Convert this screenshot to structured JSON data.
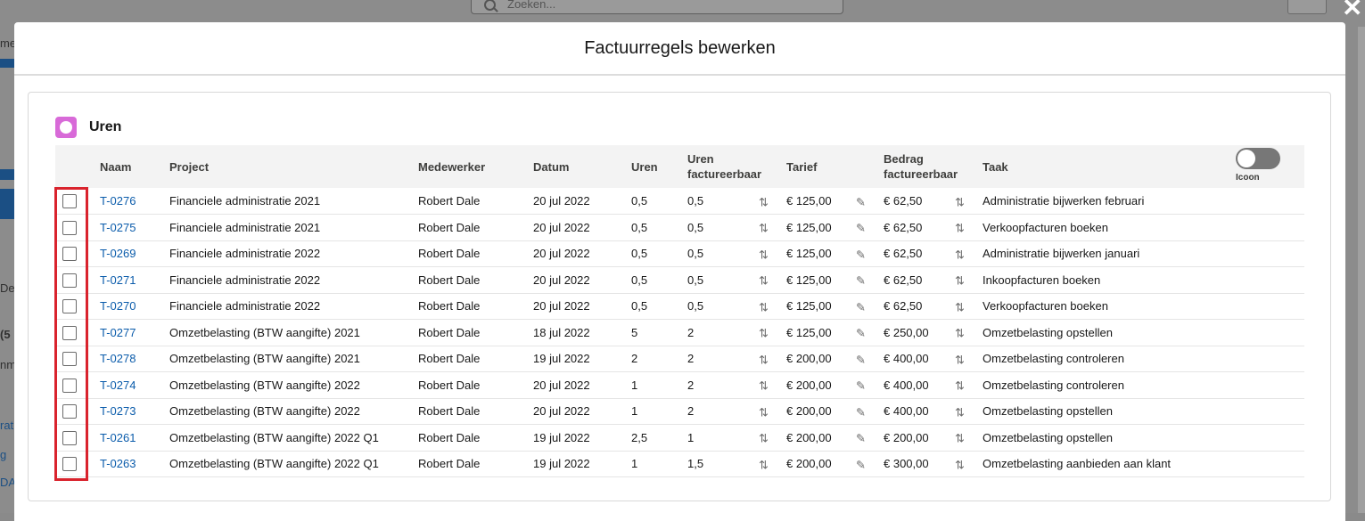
{
  "background": {
    "search_placeholder": "Zoeken...",
    "left_fragments": [
      "me",
      "De",
      "(5",
      "nm",
      "rat",
      "g",
      "DA"
    ]
  },
  "modal": {
    "title": "Factuurregels bewerken"
  },
  "section": {
    "title": "Uren",
    "toggle_label": "Icoon"
  },
  "table": {
    "headers": {
      "naam": "Naam",
      "project": "Project",
      "medewerker": "Medewerker",
      "datum": "Datum",
      "uren": "Uren",
      "uren_fact_1": "Uren",
      "uren_fact_2": "factureerbaar",
      "tarief": "Tarief",
      "bedrag_1": "Bedrag",
      "bedrag_2": "factureerbaar",
      "taak": "Taak"
    },
    "rows": [
      {
        "naam": "T-0276",
        "project": "Financiele administratie 2021",
        "medewerker": "Robert Dale",
        "datum": "20 jul 2022",
        "uren": "0,5",
        "uren_fact": "0,5",
        "tarief": "€ 125,00",
        "bedrag": "€ 62,50",
        "taak": "Administratie bijwerken februari"
      },
      {
        "naam": "T-0275",
        "project": "Financiele administratie 2021",
        "medewerker": "Robert Dale",
        "datum": "20 jul 2022",
        "uren": "0,5",
        "uren_fact": "0,5",
        "tarief": "€ 125,00",
        "bedrag": "€ 62,50",
        "taak": "Verkoopfacturen boeken"
      },
      {
        "naam": "T-0269",
        "project": "Financiele administratie 2022",
        "medewerker": "Robert Dale",
        "datum": "20 jul 2022",
        "uren": "0,5",
        "uren_fact": "0,5",
        "tarief": "€ 125,00",
        "bedrag": "€ 62,50",
        "taak": "Administratie bijwerken januari"
      },
      {
        "naam": "T-0271",
        "project": "Financiele administratie 2022",
        "medewerker": "Robert Dale",
        "datum": "20 jul 2022",
        "uren": "0,5",
        "uren_fact": "0,5",
        "tarief": "€ 125,00",
        "bedrag": "€ 62,50",
        "taak": "Inkoopfacturen boeken"
      },
      {
        "naam": "T-0270",
        "project": "Financiele administratie 2022",
        "medewerker": "Robert Dale",
        "datum": "20 jul 2022",
        "uren": "0,5",
        "uren_fact": "0,5",
        "tarief": "€ 125,00",
        "bedrag": "€ 62,50",
        "taak": "Verkoopfacturen boeken"
      },
      {
        "naam": "T-0277",
        "project": "Omzetbelasting (BTW aangifte) 2021",
        "medewerker": "Robert Dale",
        "datum": "18 jul 2022",
        "uren": "5",
        "uren_fact": "2",
        "tarief": "€ 125,00",
        "bedrag": "€ 250,00",
        "taak": "Omzetbelasting opstellen"
      },
      {
        "naam": "T-0278",
        "project": "Omzetbelasting (BTW aangifte) 2021",
        "medewerker": "Robert Dale",
        "datum": "19 jul 2022",
        "uren": "2",
        "uren_fact": "2",
        "tarief": "€ 200,00",
        "bedrag": "€ 400,00",
        "taak": "Omzetbelasting controleren"
      },
      {
        "naam": "T-0274",
        "project": "Omzetbelasting (BTW aangifte) 2022",
        "medewerker": "Robert Dale",
        "datum": "20 jul 2022",
        "uren": "1",
        "uren_fact": "2",
        "tarief": "€ 200,00",
        "bedrag": "€ 400,00",
        "taak": "Omzetbelasting controleren"
      },
      {
        "naam": "T-0273",
        "project": "Omzetbelasting (BTW aangifte) 2022",
        "medewerker": "Robert Dale",
        "datum": "20 jul 2022",
        "uren": "1",
        "uren_fact": "2",
        "tarief": "€ 200,00",
        "bedrag": "€ 400,00",
        "taak": "Omzetbelasting opstellen"
      },
      {
        "naam": "T-0261",
        "project": "Omzetbelasting (BTW aangifte) 2022 Q1",
        "medewerker": "Robert Dale",
        "datum": "19 jul 2022",
        "uren": "2,5",
        "uren_fact": "1",
        "tarief": "€ 200,00",
        "bedrag": "€ 200,00",
        "taak": "Omzetbelasting opstellen"
      },
      {
        "naam": "T-0263",
        "project": "Omzetbelasting (BTW aangifte) 2022 Q1",
        "medewerker": "Robert Dale",
        "datum": "19 jul 2022",
        "uren": "1",
        "uren_fact": "1,5",
        "tarief": "€ 200,00",
        "bedrag": "€ 300,00",
        "taak": "Omzetbelasting aanbieden aan klant"
      }
    ]
  },
  "icons": {
    "swap": "swap-arrows-icon",
    "edit": "pencil-icon"
  },
  "colors": {
    "link": "#0b5cab",
    "section_icon": "#d86ad8",
    "highlight": "#d9232d"
  }
}
